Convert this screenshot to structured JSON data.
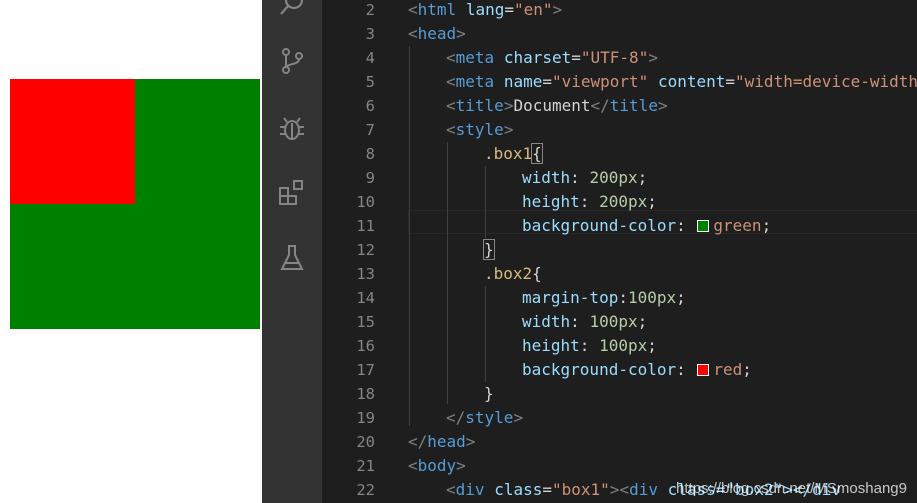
{
  "preview": {
    "box1_color": "#008000",
    "box2_color": "#ff0000"
  },
  "activity_bar": {
    "icons": [
      "search-icon",
      "source-control-icon",
      "debug-icon",
      "extensions-icon",
      "testing-icon"
    ]
  },
  "editor": {
    "line_numbers": [
      "2",
      "3",
      "4",
      "5",
      "6",
      "7",
      "8",
      "9",
      "10",
      "11",
      "12",
      "13",
      "14",
      "15",
      "16",
      "17",
      "18",
      "19",
      "20",
      "21",
      "22"
    ],
    "code": {
      "l2": {
        "open": "<",
        "tag": "html",
        "attr": "lang",
        "eq": "=",
        "val": "\"en\"",
        "close": ">"
      },
      "l3": {
        "open": "<",
        "tag": "head",
        "close": ">"
      },
      "l4": {
        "open": "<",
        "tag": "meta",
        "attr": "charset",
        "eq": "=",
        "val": "\"UTF-8\"",
        "close": ">"
      },
      "l5": {
        "open": "<",
        "tag": "meta",
        "attr1": "name",
        "eq1": "=",
        "val1": "\"viewport\"",
        "attr2": "content",
        "eq2": "=",
        "val2": "\"width=device-width"
      },
      "l6": {
        "open": "<",
        "tag": "title",
        "close": ">",
        "text": "Document",
        "open2": "</",
        "tag2": "title",
        "close2": ">"
      },
      "l7": {
        "open": "<",
        "tag": "style",
        "close": ">"
      },
      "l8": {
        "selector": ".box1",
        "brace": "{"
      },
      "l9": {
        "prop": "width",
        "colon": ": ",
        "num": "200px",
        "semi": ";"
      },
      "l10": {
        "prop": "height",
        "colon": ": ",
        "num": "200px",
        "semi": ";"
      },
      "l11": {
        "prop": "background-color",
        "colon": ": ",
        "val": "green",
        "semi": ";",
        "swatch": "#008000"
      },
      "l12": {
        "brace": "}"
      },
      "l13": {
        "selector": ".box2",
        "brace": "{"
      },
      "l14": {
        "prop": "margin-top",
        "colon": ":",
        "num": "100px",
        "semi": ";"
      },
      "l15": {
        "prop": "width",
        "colon": ": ",
        "num": "100px",
        "semi": ";"
      },
      "l16": {
        "prop": "height",
        "colon": ": ",
        "num": "100px",
        "semi": ";"
      },
      "l17": {
        "prop": "background-color",
        "colon": ": ",
        "val": "red",
        "semi": ";",
        "swatch": "#ff0000"
      },
      "l18": {
        "brace": "}"
      },
      "l19": {
        "open": "</",
        "tag": "style",
        "close": ">"
      },
      "l20": {
        "open": "</",
        "tag": "head",
        "close": ">"
      },
      "l21": {
        "open": "<",
        "tag": "body",
        "close": ">"
      },
      "l22": {
        "open": "<",
        "tag": "div",
        "attr": "class",
        "eq": "=",
        "val": "\"box1\"",
        "close": ">",
        "open2": "<",
        "tag2": "div",
        "rest": " class=\"box2\"></div"
      }
    }
  },
  "watermark": "https://blog.csdn.net/MSmoshang9"
}
